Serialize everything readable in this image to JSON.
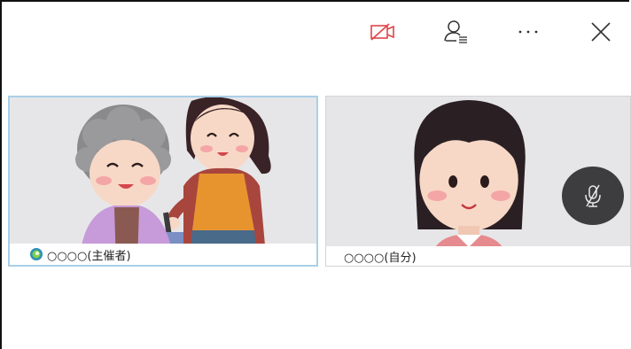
{
  "toolbar": {
    "icons": [
      "camera-off-icon",
      "participants-icon",
      "more-icon",
      "close-icon"
    ]
  },
  "tiles": [
    {
      "name_label": "○○○○(主催者)",
      "role": "host",
      "badge_icon": "host-badge-icon"
    },
    {
      "name_label": "○○○○(自分)",
      "role": "self",
      "overlay_icon": "mic-off-icon"
    }
  ],
  "colors": {
    "camera_off_red": "#e0454a",
    "host_tile_border": "#a9cfe8",
    "tile_background": "#e8e8ea",
    "mute_button": "#3d3d3f"
  }
}
